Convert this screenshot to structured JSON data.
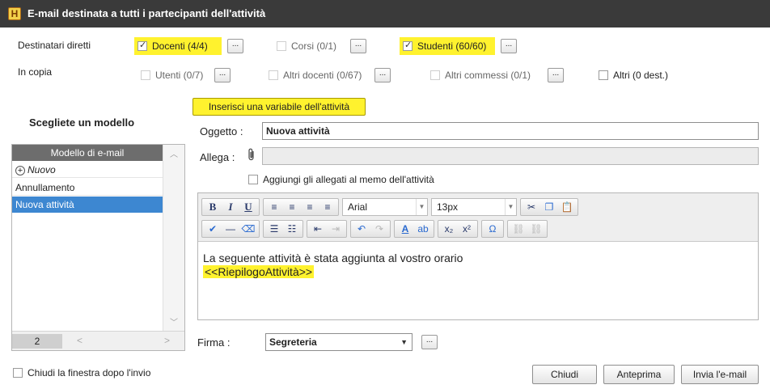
{
  "window": {
    "title": "E-mail destinata a tutti i partecipanti dell'attività",
    "app_icon_letter": "H"
  },
  "recipients": {
    "direct_label": "Destinatari diretti",
    "cc_label": "In copia",
    "direct": [
      {
        "label": "Docenti (4/4)",
        "checked": true,
        "highlighted": true
      },
      {
        "label": "Corsi (0/1)",
        "checked": false,
        "highlighted": false
      },
      {
        "label": "Studenti (60/60)",
        "checked": true,
        "highlighted": true
      }
    ],
    "cc": [
      {
        "label": "Utenti (0/7)",
        "checked": false
      },
      {
        "label": "Altri docenti (0/67)",
        "checked": false
      },
      {
        "label": "Altri commessi (0/1)",
        "checked": false
      },
      {
        "label": "Altri (0 dest.)",
        "checked": false
      }
    ],
    "dots_label": "..."
  },
  "insert_variable_button": "Inserisci una variabile dell'attività",
  "templates": {
    "section_title": "Scegliete un modello",
    "column_header": "Modello di e-mail",
    "new_item": "Nuovo",
    "items": [
      "Annullamento",
      "Nuova attività"
    ],
    "selected": "Nuova attività",
    "count": "2"
  },
  "form": {
    "subject_label": "Oggetto :",
    "subject_value": "Nuova attività",
    "attach_label": "Allega :",
    "attach_to_memo_label": "Aggiungi gli allegati al memo dell'attività",
    "signature_label": "Firma :",
    "signature_value": "Segreteria"
  },
  "editor": {
    "font_family": "Arial",
    "font_size": "13px",
    "body_line1": "La seguente attività è stata aggiunta al vostro orario",
    "body_line2": "<<RiepilogoAttività>>"
  },
  "footer": {
    "close_after_send_label": "Chiudi la finestra dopo l'invio",
    "buttons": {
      "close": "Chiudi",
      "preview": "Anteprima",
      "send": "Invia l'e-mail"
    }
  },
  "colors": {
    "highlight": "#fff22e",
    "selection": "#3d87d1",
    "titlebar": "#3a3a3a"
  }
}
